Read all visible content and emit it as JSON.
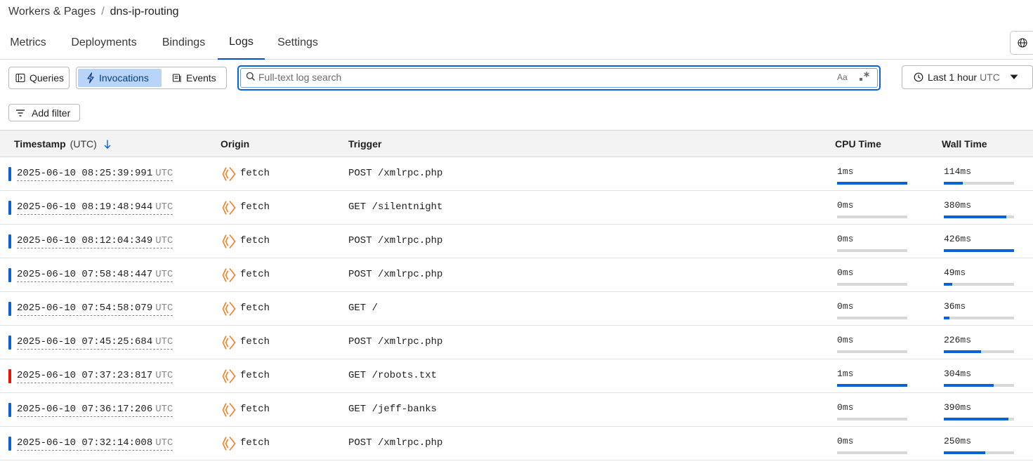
{
  "breadcrumb": {
    "parent": "Workers & Pages",
    "separator": "/",
    "current": "dns-ip-routing"
  },
  "tabs": [
    {
      "label": "Metrics",
      "active": false
    },
    {
      "label": "Deployments",
      "active": false
    },
    {
      "label": "Bindings",
      "active": false
    },
    {
      "label": "Logs",
      "active": true
    },
    {
      "label": "Settings",
      "active": false
    }
  ],
  "toolbar": {
    "queries_label": "Queries",
    "invocations_label": "Invocations",
    "events_label": "Events",
    "search_placeholder": "Full-text log search",
    "search_value": "",
    "case_label": "Aa",
    "time_range_label": "Last 1 hour",
    "time_range_tz": "UTC",
    "add_filter_label": "Add filter"
  },
  "colors": {
    "accent": "#0b61d6",
    "segment_active_bg": "#b8d4f8",
    "origin_icon": "#f38020",
    "status_ok": "#0b61d6",
    "status_error": "#e81403"
  },
  "table": {
    "columns": {
      "timestamp": "Timestamp",
      "timestamp_sub": "(UTC)",
      "origin": "Origin",
      "trigger": "Trigger",
      "cpu_time": "CPU Time",
      "wall_time": "Wall Time"
    },
    "sort_icon": "arrow-down-icon",
    "rows": [
      {
        "timestamp": "2025-06-10 08:25:39:991",
        "tz": "UTC",
        "status": "ok",
        "origin": "fetch",
        "trigger": "POST /xmlrpc.php",
        "cpu_value": "1",
        "cpu_unit": "ms",
        "cpu_fill": 1.0,
        "wall_value": "114",
        "wall_unit": "ms",
        "wall_fill": 0.27
      },
      {
        "timestamp": "2025-06-10 08:19:48:944",
        "tz": "UTC",
        "status": "ok",
        "origin": "fetch",
        "trigger": "GET /silentnight",
        "cpu_value": "0",
        "cpu_unit": "ms",
        "cpu_fill": 0,
        "wall_value": "380",
        "wall_unit": "ms",
        "wall_fill": 0.89
      },
      {
        "timestamp": "2025-06-10 08:12:04:349",
        "tz": "UTC",
        "status": "ok",
        "origin": "fetch",
        "trigger": "POST /xmlrpc.php",
        "cpu_value": "0",
        "cpu_unit": "ms",
        "cpu_fill": 0,
        "wall_value": "426",
        "wall_unit": "ms",
        "wall_fill": 1.0
      },
      {
        "timestamp": "2025-06-10 07:58:48:447",
        "tz": "UTC",
        "status": "ok",
        "origin": "fetch",
        "trigger": "POST /xmlrpc.php",
        "cpu_value": "0",
        "cpu_unit": "ms",
        "cpu_fill": 0,
        "wall_value": "49",
        "wall_unit": "ms",
        "wall_fill": 0.12
      },
      {
        "timestamp": "2025-06-10 07:54:58:079",
        "tz": "UTC",
        "status": "ok",
        "origin": "fetch",
        "trigger": "GET /",
        "cpu_value": "0",
        "cpu_unit": "ms",
        "cpu_fill": 0,
        "wall_value": "36",
        "wall_unit": "ms",
        "wall_fill": 0.08
      },
      {
        "timestamp": "2025-06-10 07:45:25:684",
        "tz": "UTC",
        "status": "ok",
        "origin": "fetch",
        "trigger": "POST /xmlrpc.php",
        "cpu_value": "0",
        "cpu_unit": "ms",
        "cpu_fill": 0,
        "wall_value": "226",
        "wall_unit": "ms",
        "wall_fill": 0.53
      },
      {
        "timestamp": "2025-06-10 07:37:23:817",
        "tz": "UTC",
        "status": "error",
        "origin": "fetch",
        "trigger": "GET /robots.txt",
        "cpu_value": "1",
        "cpu_unit": "ms",
        "cpu_fill": 1.0,
        "wall_value": "304",
        "wall_unit": "ms",
        "wall_fill": 0.71
      },
      {
        "timestamp": "2025-06-10 07:36:17:206",
        "tz": "UTC",
        "status": "ok",
        "origin": "fetch",
        "trigger": "GET /jeff-banks",
        "cpu_value": "0",
        "cpu_unit": "ms",
        "cpu_fill": 0,
        "wall_value": "390",
        "wall_unit": "ms",
        "wall_fill": 0.92
      },
      {
        "timestamp": "2025-06-10 07:32:14:008",
        "tz": "UTC",
        "status": "ok",
        "origin": "fetch",
        "trigger": "POST /xmlrpc.php",
        "cpu_value": "0",
        "cpu_unit": "ms",
        "cpu_fill": 0,
        "wall_value": "250",
        "wall_unit": "ms",
        "wall_fill": 0.59
      }
    ]
  }
}
